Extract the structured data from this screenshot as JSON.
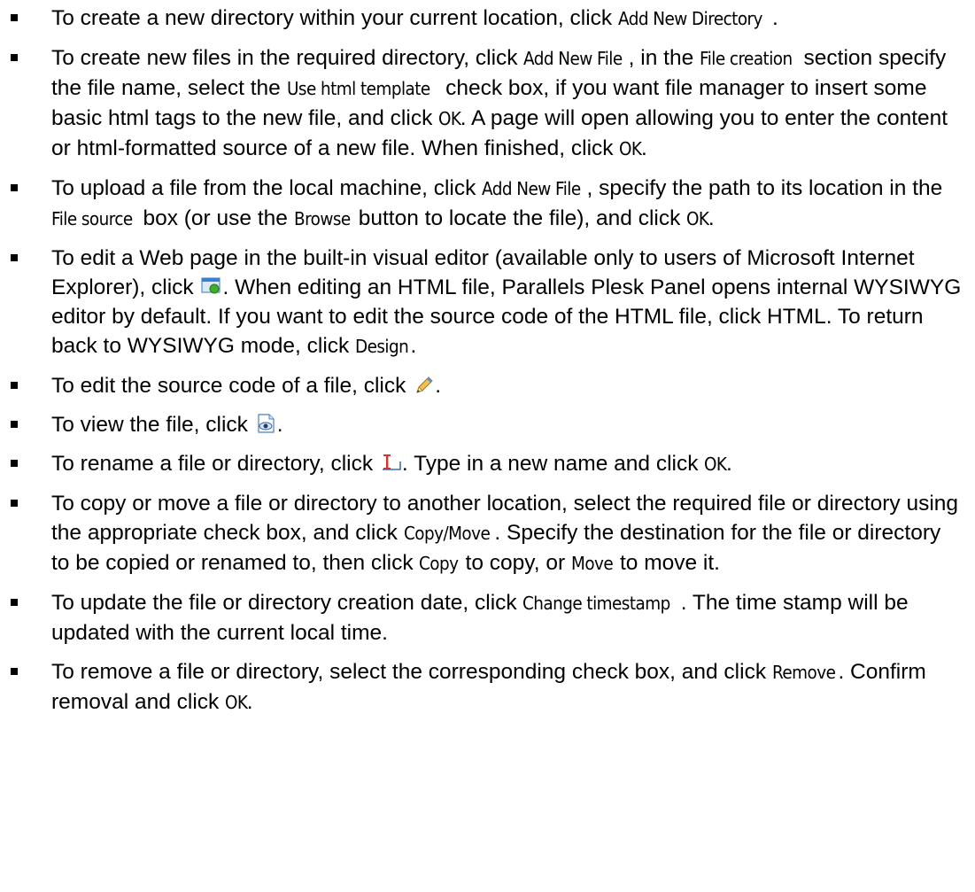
{
  "items": [
    {
      "segments": [
        {
          "t": "To create a new directory within your current location, click "
        },
        {
          "t": "Add New Directory",
          "ui": true
        },
        {
          "t": "."
        }
      ]
    },
    {
      "segments": [
        {
          "t": "To create new files in the required directory, click "
        },
        {
          "t": "Add New File",
          "ui": true
        },
        {
          "t": ", in the "
        },
        {
          "t": "File creation",
          "ui": true
        },
        {
          "t": " section specify the file name, select the "
        },
        {
          "t": "Use html template",
          "ui": true
        },
        {
          "t": " check box, if you want file manager to insert some basic html tags to the new file, and click "
        },
        {
          "t": "OK",
          "ui": true
        },
        {
          "t": ". A page will open allowing you to enter the content or html-formatted source of a new file. When finished, click "
        },
        {
          "t": "OK",
          "ui": true
        },
        {
          "t": "."
        }
      ]
    },
    {
      "segments": [
        {
          "t": "To upload a file from the local machine, click "
        },
        {
          "t": "Add New File",
          "ui": true
        },
        {
          "t": ", specify the path to its location in the "
        },
        {
          "t": "File source",
          "ui": true
        },
        {
          "t": " box (or use the "
        },
        {
          "t": "Browse",
          "ui": true
        },
        {
          "t": " button to locate the file), and click "
        },
        {
          "t": "OK",
          "ui": true
        },
        {
          "t": "."
        }
      ]
    },
    {
      "segments": [
        {
          "t": "To edit a Web page in the built-in visual editor (available only to users of Microsoft Internet Explorer), click "
        },
        {
          "icon": "visual-editor-icon"
        },
        {
          "t": ". When editing an HTML file, Parallels Plesk Panel opens internal WYSIWYG editor by default. If you want to edit the source code of the HTML file, click HTML. To return back to WYSIWYG mode, click "
        },
        {
          "t": "Design",
          "ui": true
        },
        {
          "t": "."
        }
      ]
    },
    {
      "segments": [
        {
          "t": "To edit the source code of a file, click "
        },
        {
          "icon": "pencil-icon"
        },
        {
          "t": "."
        }
      ]
    },
    {
      "segments": [
        {
          "t": "To view the file, click "
        },
        {
          "icon": "view-file-icon"
        },
        {
          "t": "."
        }
      ]
    },
    {
      "segments": [
        {
          "t": "To rename a file or directory, click "
        },
        {
          "icon": "rename-icon"
        },
        {
          "t": ". Type in a new name and click "
        },
        {
          "t": "OK",
          "ui": true
        },
        {
          "t": "."
        }
      ]
    },
    {
      "segments": [
        {
          "t": "To copy or move a file or directory to another location, select the required file or directory using the appropriate check box, and click "
        },
        {
          "t": "Copy/Move",
          "ui": true
        },
        {
          "t": ". Specify the destination for the file or directory to be copied or renamed to, then click "
        },
        {
          "t": "Copy",
          "ui": true
        },
        {
          "t": " to copy, or "
        },
        {
          "t": "Move",
          "ui": true
        },
        {
          "t": " to move it."
        }
      ]
    },
    {
      "segments": [
        {
          "t": "To update the file or directory creation date, click "
        },
        {
          "t": "Change timestamp",
          "ui": true
        },
        {
          "t": ". The time stamp will be updated with the current local time."
        }
      ]
    },
    {
      "segments": [
        {
          "t": "To remove a file or directory, select the corresponding check box, and click "
        },
        {
          "t": "Remove",
          "ui": true
        },
        {
          "t": ". Confirm removal and click "
        },
        {
          "t": "OK",
          "ui": true
        },
        {
          "t": "."
        }
      ]
    }
  ]
}
